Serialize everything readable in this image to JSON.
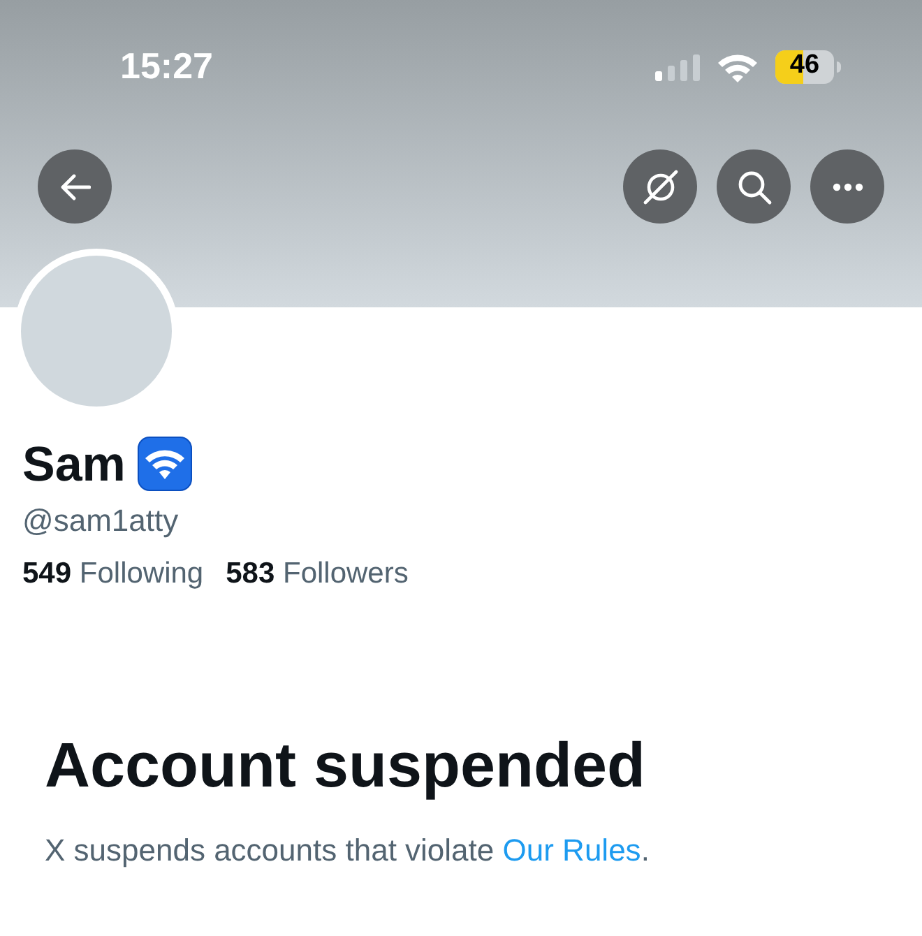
{
  "status_bar": {
    "time": "15:27",
    "battery": "46"
  },
  "profile": {
    "name": "Sam",
    "handle": "@sam1atty",
    "stats": [
      {
        "count": "549",
        "label": "Following"
      },
      {
        "count": "583",
        "label": "Followers"
      }
    ]
  },
  "notice": {
    "title": "Account suspended",
    "text": "X suspends accounts that violate ",
    "link": "Our Rules",
    "end": "."
  }
}
